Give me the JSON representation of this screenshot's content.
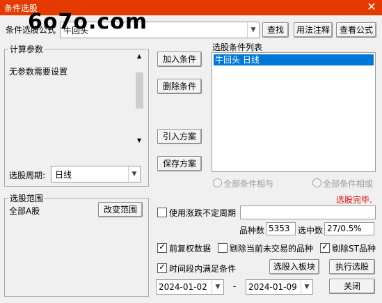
{
  "window": {
    "title": "条件选股",
    "close_glyph": "✕"
  },
  "watermark": "6o7o.com",
  "formula": {
    "label": "条件选股公式",
    "value": "牛回头",
    "buttons": {
      "find": "查找",
      "usage": "用法注释",
      "view": "查看公式"
    }
  },
  "params": {
    "group_label": "计算参数",
    "text": "无参数需要设置",
    "period_label": "选股周期:",
    "period_value": "日线"
  },
  "actions": {
    "add": "加入条件",
    "remove": "删除条件",
    "import": "引入方案",
    "save": "保存方案"
  },
  "conditions": {
    "label": "选股条件列表",
    "items": [
      "牛回头  日线"
    ],
    "mode_and": "全部条件相与",
    "mode_or": "全部条件相或"
  },
  "status": "选股完毕.",
  "scope": {
    "group_label": "选股范围",
    "value": "全部A股",
    "change_button": "改变范围"
  },
  "options": {
    "variable_period": "使用涨跌不定周期",
    "count_label": "品种数",
    "count_value": "5353",
    "selected_label": "选中数",
    "selected_value": "27/0.5%",
    "forward_adjust": "前复权数据",
    "exclude_untraded": "剔除当前未交易的品种",
    "exclude_st": "剔除ST品种",
    "period_condition": "时间段内满足条件"
  },
  "dates": {
    "start": "2024-01-02",
    "dash": "-",
    "end": "2024-01-09"
  },
  "bottom_buttons": {
    "to_block": "选股入板块",
    "execute": "执行选股",
    "close": "关闭"
  },
  "icons": {
    "combo": "chevron-down-icon",
    "check": "check-icon",
    "close": "close-icon"
  }
}
